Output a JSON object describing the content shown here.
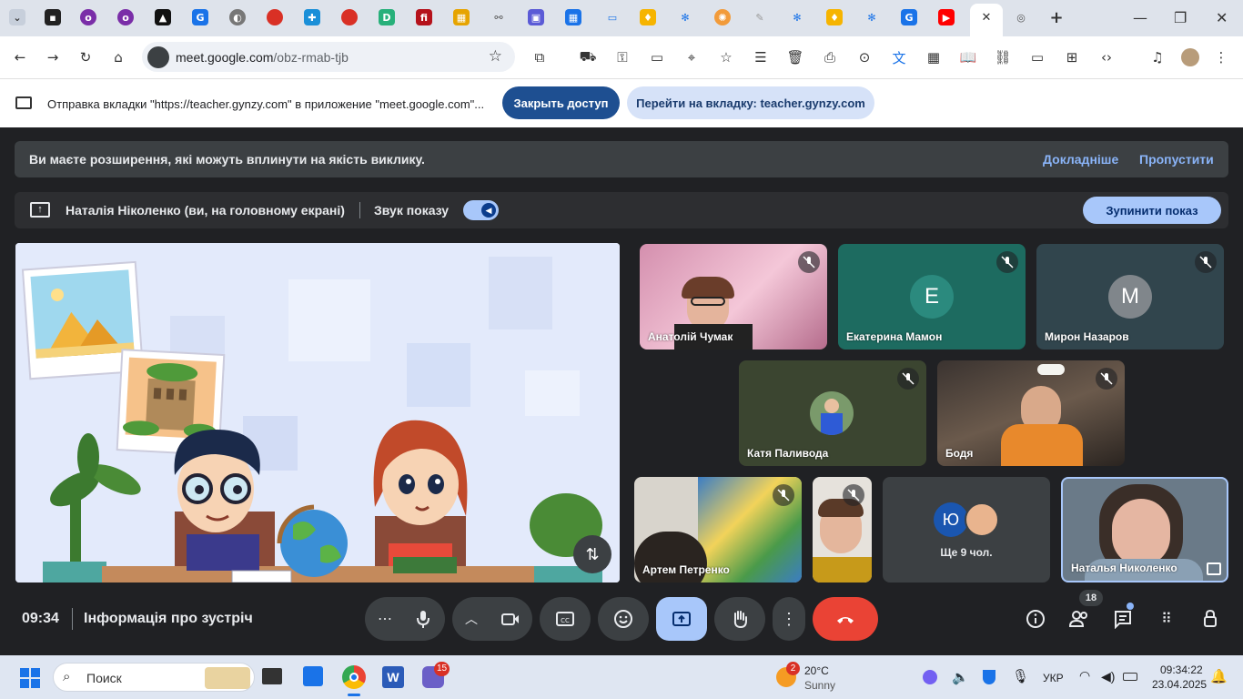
{
  "browser": {
    "tabs_favicons": [
      "tab-list-icon",
      "opera-icon",
      "opera-icon",
      "opera-icon",
      "deepl-icon",
      "google-icon",
      "globe-icon",
      "red-ball-icon",
      "puzzle-icon",
      "red-ball-icon",
      "d-icon",
      "fi-icon",
      "wordwall-icon",
      "link-icon",
      "chat-icon",
      "grid-icon",
      "screen-icon",
      "bell-icon",
      "snowflake-icon",
      "pinwheel-icon",
      "note-icon",
      "snowflake-icon",
      "bell-icon",
      "snowflake-icon",
      "g-icon",
      "youtube-icon",
      "meet-tab-close-icon",
      "chrome-icon",
      "new-tab-icon"
    ],
    "active_tab_close": "✕",
    "new_tab": "+",
    "url_host": "meet.google.com",
    "url_path": "/obz-rmab-tjb"
  },
  "infobar": {
    "message": "Отправка вкладки \"https://teacher.gynzy.com\" в приложение \"meet.google.com\"...",
    "stop_button": "Закрыть доступ",
    "switch_button": "Перейти на вкладку: teacher.gynzy.com"
  },
  "warning": {
    "text": "Ви маєте розширення, які можуть вплинути на якість виклику.",
    "learn_more": "Докладніше",
    "skip": "Пропустити"
  },
  "presenting": {
    "presenter": "Наталія Ніколенко (ви, на головному екрані)",
    "sound_label": "Звук показу",
    "sound_on": true,
    "stop_button": "Зупинити показ"
  },
  "participants": [
    {
      "name": "Анатолій Чумак",
      "type": "video",
      "muted": true
    },
    {
      "name": "Екатерина Мамон",
      "type": "avatar",
      "initial": "E",
      "color": "#2b8a7e",
      "muted": true
    },
    {
      "name": "Мирон Назаров",
      "type": "avatar",
      "initial": "M",
      "color": "#80868b",
      "muted": true
    },
    {
      "name": "Катя Паливода",
      "type": "photo",
      "muted": true
    },
    {
      "name": "Бодя",
      "type": "video",
      "muted": true
    },
    {
      "name": "Артем Петренко",
      "type": "video",
      "muted": true
    },
    {
      "name": "",
      "type": "video",
      "muted": true
    },
    {
      "name": "Ще 9 чол.",
      "type": "group",
      "initial": "Ю"
    },
    {
      "name": "Наталья Николенко",
      "type": "video",
      "self": true
    }
  ],
  "controls": {
    "time": "09:34",
    "meeting_info": "Інформація про зустріч",
    "participant_count": "18",
    "colors": {
      "end_call": "#ea4335",
      "present_active": "#a8c7fa"
    }
  },
  "taskbar": {
    "search_placeholder": "Поиск",
    "teams_badge": "15",
    "weather_badge": "2",
    "weather_temp": "20°C",
    "weather_desc": "Sunny",
    "language": "УКР",
    "time": "09:34:22",
    "date": "23.04.2025"
  }
}
